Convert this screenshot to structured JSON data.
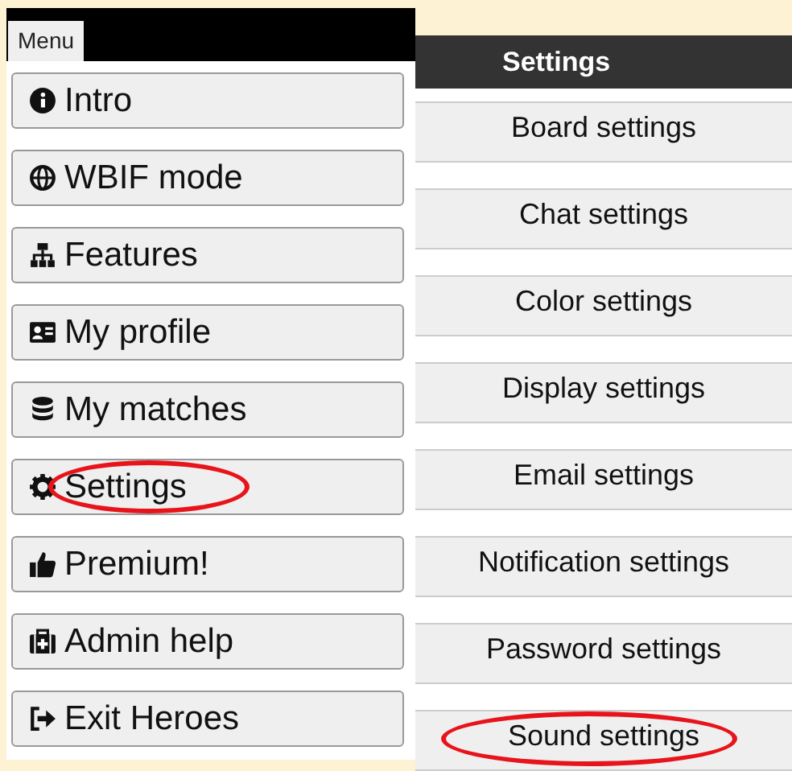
{
  "menu": {
    "tab": "Menu",
    "items": [
      {
        "label": "Intro",
        "highlighted": false
      },
      {
        "label": "WBIF mode",
        "highlighted": false
      },
      {
        "label": "Features",
        "highlighted": false
      },
      {
        "label": "My profile",
        "highlighted": false
      },
      {
        "label": "My matches",
        "highlighted": false
      },
      {
        "label": "Settings",
        "highlighted": true
      },
      {
        "label": "Premium!",
        "highlighted": false
      },
      {
        "label": "Admin help",
        "highlighted": false
      },
      {
        "label": "Exit Heroes",
        "highlighted": false
      }
    ]
  },
  "settings": {
    "title": "Settings",
    "items": [
      {
        "label": "Board settings",
        "highlighted": false
      },
      {
        "label": "Chat settings",
        "highlighted": false
      },
      {
        "label": "Color settings",
        "highlighted": false
      },
      {
        "label": "Display settings",
        "highlighted": false
      },
      {
        "label": "Email settings",
        "highlighted": false
      },
      {
        "label": "Notification settings",
        "highlighted": false
      },
      {
        "label": "Password settings",
        "highlighted": false
      },
      {
        "label": "Sound settings",
        "highlighted": true
      }
    ]
  }
}
